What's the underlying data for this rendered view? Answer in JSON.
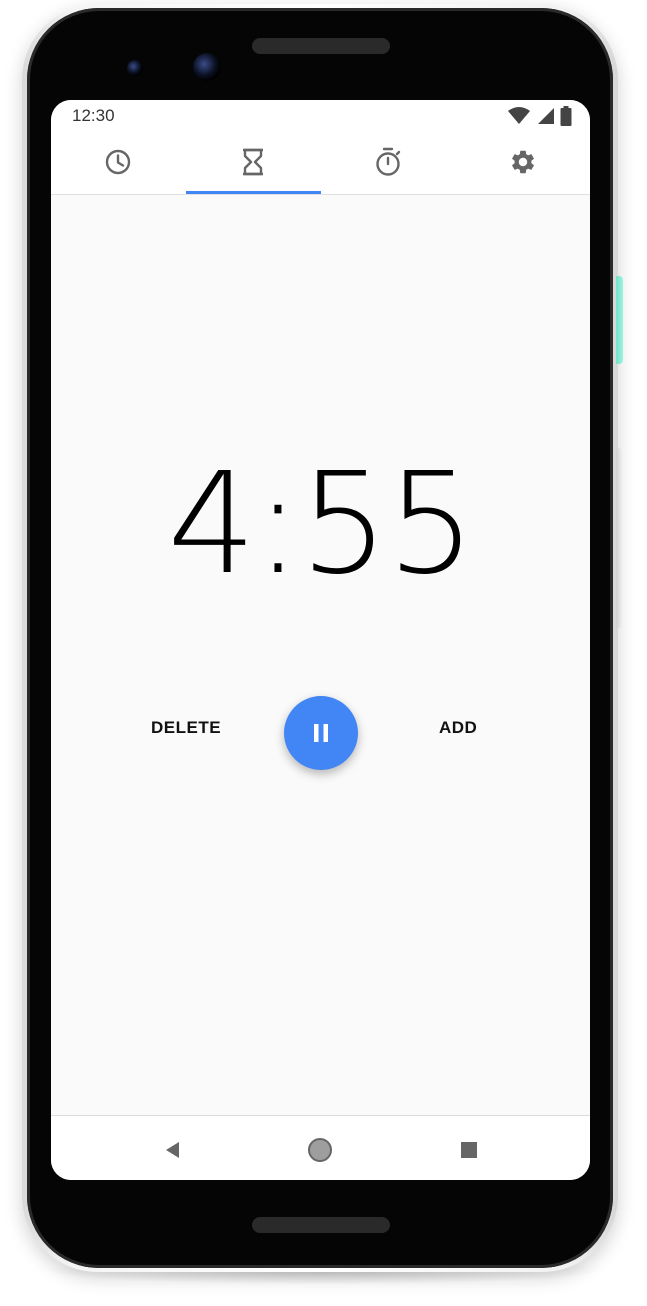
{
  "status_bar": {
    "time": "12:30",
    "icons": [
      "wifi-icon",
      "cellular-signal-icon",
      "battery-icon"
    ]
  },
  "tabs": [
    {
      "name": "clock",
      "icon": "clock-icon",
      "selected": false
    },
    {
      "name": "timer",
      "icon": "hourglass-icon",
      "selected": true
    },
    {
      "name": "stopwatch",
      "icon": "stopwatch-icon",
      "selected": false
    },
    {
      "name": "settings",
      "icon": "gear-icon",
      "selected": false
    }
  ],
  "timer": {
    "remaining": "4:55",
    "delete_label": "DELETE",
    "add_label": "ADD",
    "fab_icon": "pause-icon"
  },
  "nav": {
    "icons": [
      "back-icon",
      "home-icon",
      "recents-icon"
    ]
  },
  "colors": {
    "accent": "#4285f4",
    "background": "#fafafa",
    "icon_gray": "#666666"
  }
}
